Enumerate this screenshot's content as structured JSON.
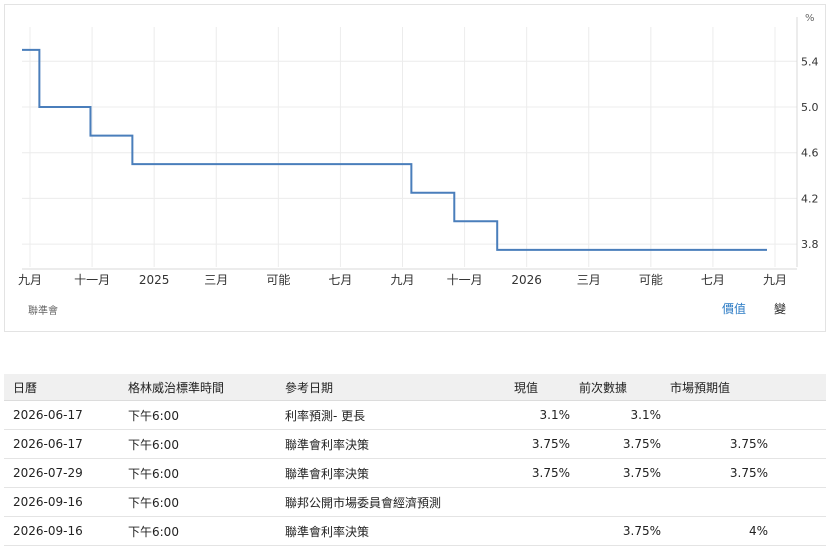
{
  "chart_data": {
    "type": "line",
    "unit_label": "%",
    "source_label": "聯準會",
    "x_ticks": [
      "九月",
      "十一月",
      "2025",
      "三月",
      "可能",
      "七月",
      "九月",
      "十一月",
      "2026",
      "三月",
      "可能",
      "七月",
      "九月"
    ],
    "y_ticks": [
      "5.4",
      "5.0",
      "4.6",
      "4.2",
      "3.8"
    ],
    "ylim": [
      3.6,
      5.7
    ],
    "x": [
      "2024-09-01",
      "2024-09-18",
      "2024-11-07",
      "2024-12-18",
      "2025-09-17",
      "2025-10-29",
      "2025-12-10",
      "2026-08-31"
    ],
    "series": [
      {
        "values": [
          5.5,
          5.0,
          4.75,
          4.5,
          4.25,
          4.0,
          3.75,
          3.75
        ]
      }
    ],
    "line_color": "#4a7ebb",
    "legend": {
      "value_label": "價值",
      "change_label": "變"
    }
  },
  "calendar": {
    "headers": [
      "日曆",
      "格林威治標準時間",
      "參考日期",
      "現值",
      "前次數據",
      "市場預期值"
    ],
    "rows": [
      {
        "date": "2026-06-17",
        "time": "下午6:00",
        "event": "利率預測- 更長",
        "actual": "3.1%",
        "previous": "3.1%",
        "consensus": ""
      },
      {
        "date": "2026-06-17",
        "time": "下午6:00",
        "event": "聯準會利率決策",
        "actual": "3.75%",
        "previous": "3.75%",
        "consensus": "3.75%"
      },
      {
        "date": "2026-07-29",
        "time": "下午6:00",
        "event": "聯準會利率決策",
        "actual": "3.75%",
        "previous": "3.75%",
        "consensus": "3.75%"
      },
      {
        "date": "2026-09-16",
        "time": "下午6:00",
        "event": "聯邦公開市場委員會經濟預測",
        "actual": "",
        "previous": "",
        "consensus": ""
      },
      {
        "date": "2026-09-16",
        "time": "下午6:00",
        "event": "聯準會利率決策",
        "actual": "",
        "previous": "3.75%",
        "consensus": "4%"
      }
    ]
  }
}
